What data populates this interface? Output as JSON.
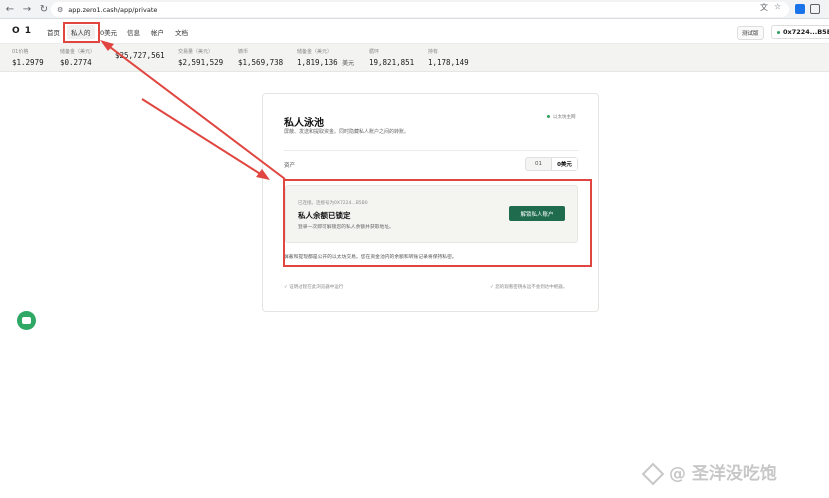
{
  "browser": {
    "url": "app.zero1.cash/app/private"
  },
  "header": {
    "logo": "O 1",
    "nav": [
      "首页",
      "私人的",
      "0美元",
      "信息",
      "帐户",
      "文档"
    ],
    "badge_button": "测试版",
    "wallet": "0x7224...B5B0"
  },
  "stats": [
    {
      "label": "01价格",
      "value": "$1.2979",
      "unit": ""
    },
    {
      "label": "储备金（美元）",
      "value": "$0.2774",
      "unit": ""
    },
    {
      "label": "",
      "value": "$25,727,561",
      "unit": ""
    },
    {
      "label": "交易量（美元）",
      "value": "$2,591,529",
      "unit": ""
    },
    {
      "label": "铸币",
      "value": "$1,569,738",
      "unit": ""
    },
    {
      "label": "储备金（美元）",
      "value": "1,819,136",
      "unit": "美元"
    },
    {
      "label": "循环",
      "value": "19,821,851",
      "unit": ""
    },
    {
      "label": "持有",
      "value": "1,178,149",
      "unit": ""
    }
  ],
  "card": {
    "title": "私人泳池",
    "subtitle": "屏蔽、发送和提取资金。同时隐藏私人账户之间的转账。",
    "network": "以太坊主网",
    "assets_label": "资产",
    "toggle": [
      "01",
      "0美元"
    ],
    "lock_panel": {
      "connected": "已连接。连接号为0X7224...B5B0",
      "title": "私人余额已锁定",
      "desc": "登录一次即可解锁您的私人余额并获取地址。",
      "button": "解锁私人账户"
    },
    "notice": "屏蔽和提现都是公开的以太坊交易。您在资金池内的余额和转账记录将保持私密。",
    "footer_left": "✓ 证明过程在此浏览器中运行",
    "footer_right": "✓ 您的观看密钥永远不会到达中继器。"
  },
  "watermark": "@ 圣洋没吃饱",
  "colors": {
    "accent_green": "#1e6b4e",
    "annotation_red": "#e0463f"
  }
}
